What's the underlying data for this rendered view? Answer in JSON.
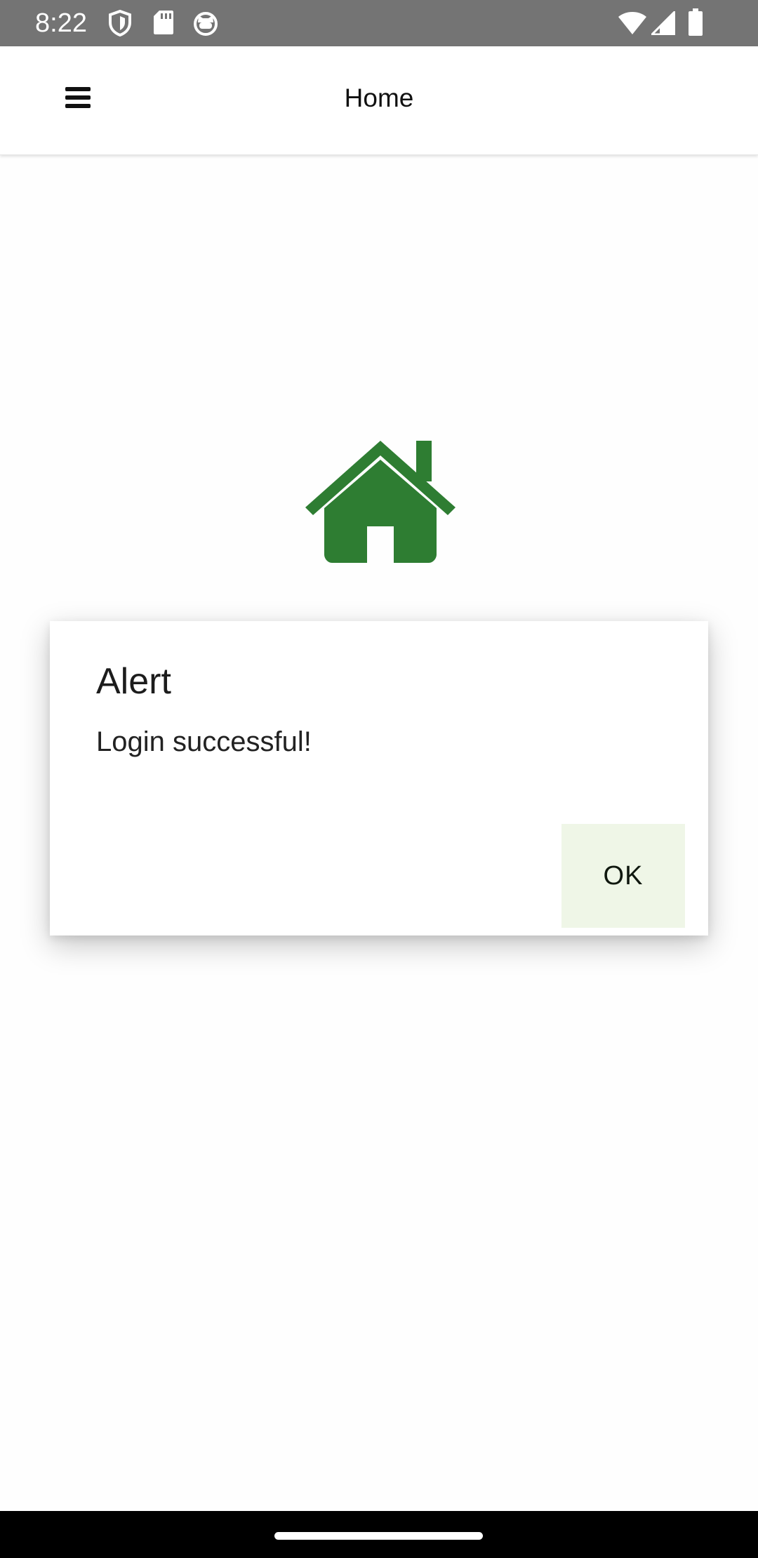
{
  "status_bar": {
    "time": "8:22",
    "left_icons": [
      "shield-icon",
      "sd-card-icon",
      "cat-face-icon"
    ],
    "right_icons": [
      "wifi-icon",
      "cellular-signal-icon",
      "battery-icon"
    ],
    "background_color": "#747474"
  },
  "app_bar": {
    "title": "Home",
    "menu_icon": "hamburger-menu-icon"
  },
  "main": {
    "icon": "home-icon",
    "icon_color": "#2e7d32"
  },
  "dialog": {
    "title": "Alert",
    "message": "Login successful!",
    "ok_label": "OK",
    "button_color": "#eff6e7"
  },
  "nav_bar": {
    "handle": "home-gesture-handle"
  }
}
